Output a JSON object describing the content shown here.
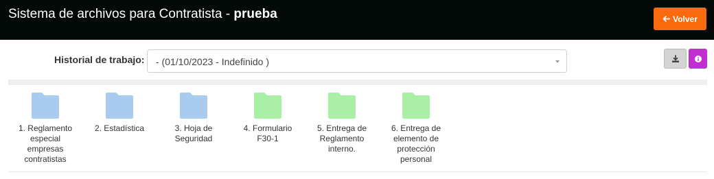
{
  "header": {
    "title_prefix": "Sistema de archivos para Contratista - ",
    "title_bold": "prueba",
    "back_label": "Volver"
  },
  "history": {
    "label": "Historial de trabajo:",
    "selected": "- (01/10/2023 - Indefinido )"
  },
  "colors": {
    "header_bg": "#030a07",
    "back_button": "#f96a0d",
    "info_button": "#c22fd1",
    "folder_blue": "#a9cbef",
    "folder_green": "#a9f0a6"
  },
  "folders": [
    {
      "label": "1. Reglamento especial empresas contratistas",
      "color": "blue"
    },
    {
      "label": "2. Estadística",
      "color": "blue"
    },
    {
      "label": "3. Hoja de Seguridad",
      "color": "blue"
    },
    {
      "label": "4. Formulario F30-1",
      "color": "green"
    },
    {
      "label": "5. Entrega de Reglamento interno.",
      "color": "green"
    },
    {
      "label": "6. Entrega de elemento de protección personal",
      "color": "green"
    }
  ]
}
